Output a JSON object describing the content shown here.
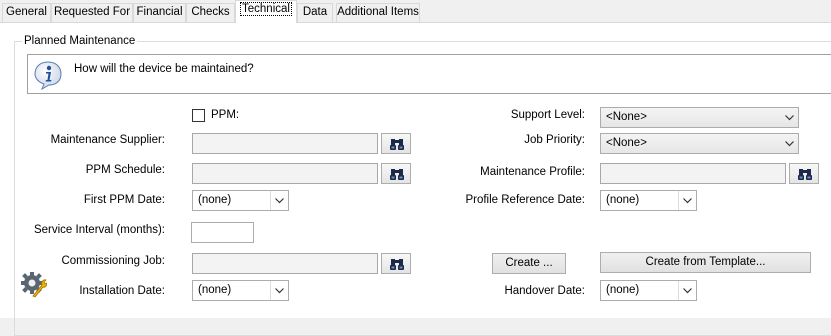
{
  "tabs": [
    {
      "label": "General"
    },
    {
      "label": "Requested For"
    },
    {
      "label": "Financial"
    },
    {
      "label": "Checks"
    },
    {
      "label": "Technical",
      "active": true
    },
    {
      "label": "Data"
    },
    {
      "label": "Additional Items"
    }
  ],
  "group": {
    "title": "Planned Maintenance",
    "info_text": "How will the device be maintained?"
  },
  "left": {
    "ppm_label": "PPM:",
    "ppm_checked": false,
    "maintenance_supplier_label": "Maintenance Supplier:",
    "maintenance_supplier_value": "",
    "ppm_schedule_label": "PPM Schedule:",
    "ppm_schedule_value": "",
    "first_ppm_date_label": "First PPM Date:",
    "first_ppm_date_value": "(none)",
    "service_interval_label": "Service Interval (months):",
    "service_interval_value": "",
    "commissioning_job_label": "Commissioning Job:",
    "commissioning_job_value": "",
    "installation_date_label": "Installation Date:",
    "installation_date_value": "(none)"
  },
  "right": {
    "support_level_label": "Support Level:",
    "support_level_value": "<None>",
    "job_priority_label": "Job Priority:",
    "job_priority_value": "<None>",
    "maintenance_profile_label": "Maintenance Profile:",
    "maintenance_profile_value": "",
    "profile_reference_date_label": "Profile Reference Date:",
    "profile_reference_date_value": "(none)",
    "create_button": "Create ...",
    "create_from_template_button": "Create from Template...",
    "handover_date_label": "Handover Date:",
    "handover_date_value": "(none)"
  },
  "icons": {
    "info": "info-icon",
    "lookup": "binoculars-icon",
    "commission": "gear-wrench-icon",
    "dropdown": "chevron-down-icon"
  }
}
